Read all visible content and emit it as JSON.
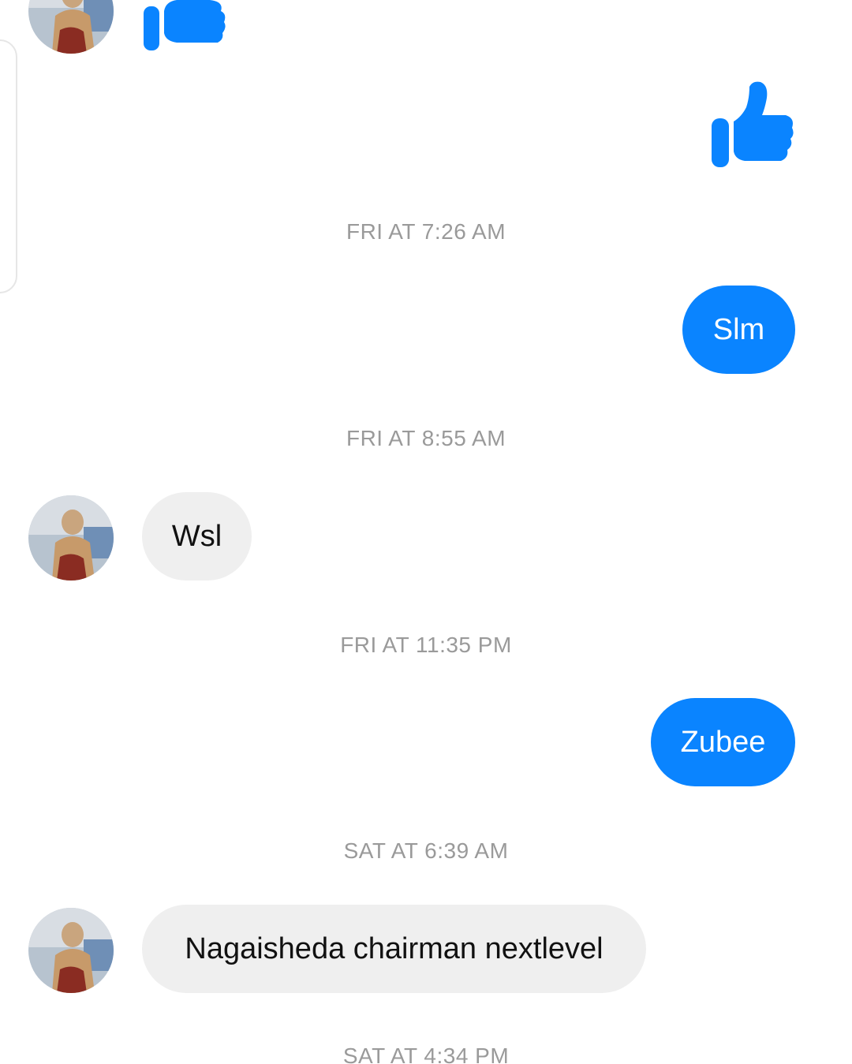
{
  "colors": {
    "accent": "#0a84ff",
    "incoming_bubble": "#efefef",
    "timestamp": "#9a9a9a"
  },
  "icons": {
    "reaction": "thumbs-up-icon"
  },
  "messages": {
    "ts1": "FRI AT 7:26 AM",
    "out1": "Slm",
    "ts2": "FRI AT 8:55 AM",
    "in1": "Wsl",
    "ts3": "FRI AT 11:35 PM",
    "out2": "Zubee",
    "ts4": "SAT AT 6:39 AM",
    "in2": "Nagaisheda chairman nextlevel",
    "ts5": "SAT AT 4:34 PM"
  }
}
